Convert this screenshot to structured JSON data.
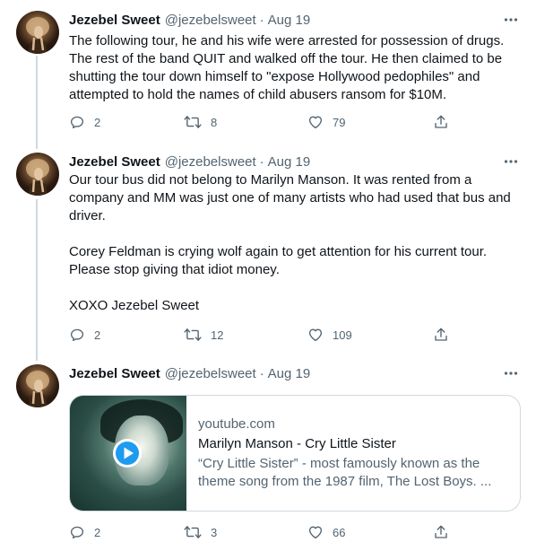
{
  "tweets": [
    {
      "name": "Jezebel Sweet",
      "handle": "@jezebelsweet",
      "separator": "·",
      "date": "Aug 19",
      "text": "The following tour, he and his wife were arrested for possession of drugs. The rest of the band QUIT and walked off the tour. He then claimed to be shutting the tour down himself to \"expose Hollywood pedophiles\" and attempted to hold the names of child abusers ransom for $10M.",
      "replies": "2",
      "retweets": "8",
      "likes": "79"
    },
    {
      "name": "Jezebel Sweet",
      "handle": "@jezebelsweet",
      "separator": "·",
      "date": "Aug 19",
      "text": "Our tour bus did not belong to Marilyn Manson. It was rented from a company and MM was just one of many artists who had used that bus and driver.\n\nCorey Feldman is crying wolf again to get attention for his current tour. Please stop giving that idiot money.\n\nXOXO Jezebel Sweet",
      "replies": "2",
      "retweets": "12",
      "likes": "109"
    },
    {
      "name": "Jezebel Sweet",
      "handle": "@jezebelsweet",
      "separator": "·",
      "date": "Aug 19",
      "card": {
        "domain": "youtube.com",
        "title": "Marilyn Manson - Cry Little Sister",
        "description": "“Cry Little Sister” - most famously known as the theme song from the 1987 film, The Lost Boys. ..."
      },
      "replies": "2",
      "retweets": "3",
      "likes": "66"
    }
  ],
  "icons": {
    "reply": "reply-icon",
    "retweet": "retweet-icon",
    "like": "heart-icon",
    "share": "share-icon",
    "more": "more-icon",
    "play": "play-icon"
  },
  "colors": {
    "text_primary": "#0f1419",
    "text_secondary": "#536471",
    "thread_line": "#cfd9de",
    "card_border": "#cfd9de",
    "play_blue": "#1d9bf0"
  }
}
